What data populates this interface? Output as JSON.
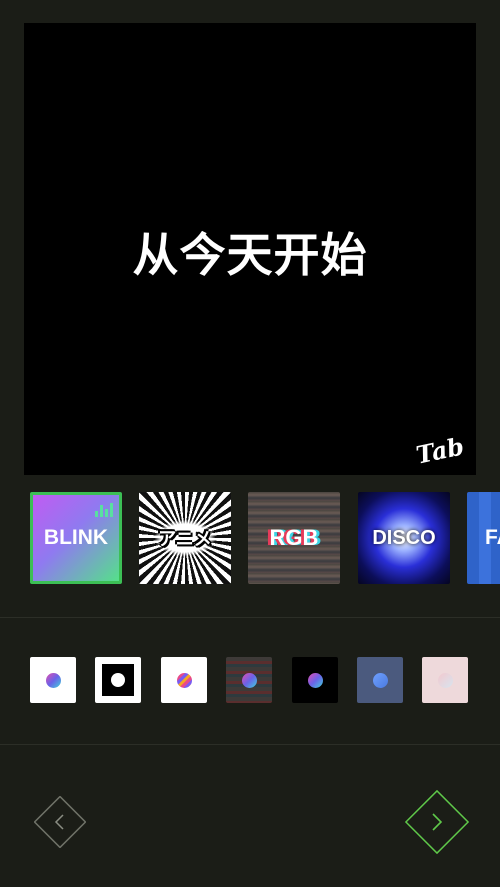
{
  "preview": {
    "text": "从今天开始",
    "watermark": "Tab"
  },
  "effects": [
    {
      "label": "BLINK",
      "selected": true
    },
    {
      "label": "アニメ"
    },
    {
      "label": "RGB"
    },
    {
      "label": "DISCO"
    },
    {
      "label": "FA"
    }
  ],
  "styles": [
    {
      "icon": "white-gradient-dot"
    },
    {
      "icon": "black-frame-dot"
    },
    {
      "icon": "white-rainbow-dot"
    },
    {
      "icon": "glitch-dot"
    },
    {
      "icon": "black-gradient-dot"
    },
    {
      "icon": "slate-blue-dot"
    },
    {
      "icon": "pink-pastel-dot"
    }
  ],
  "navigation": {
    "prev_icon": "chevron-left-icon",
    "next_icon": "chevron-right-icon"
  },
  "colors": {
    "background": "#1b1d17",
    "accent_green": "#5fc94a",
    "selected_border": "#3cbf55"
  }
}
